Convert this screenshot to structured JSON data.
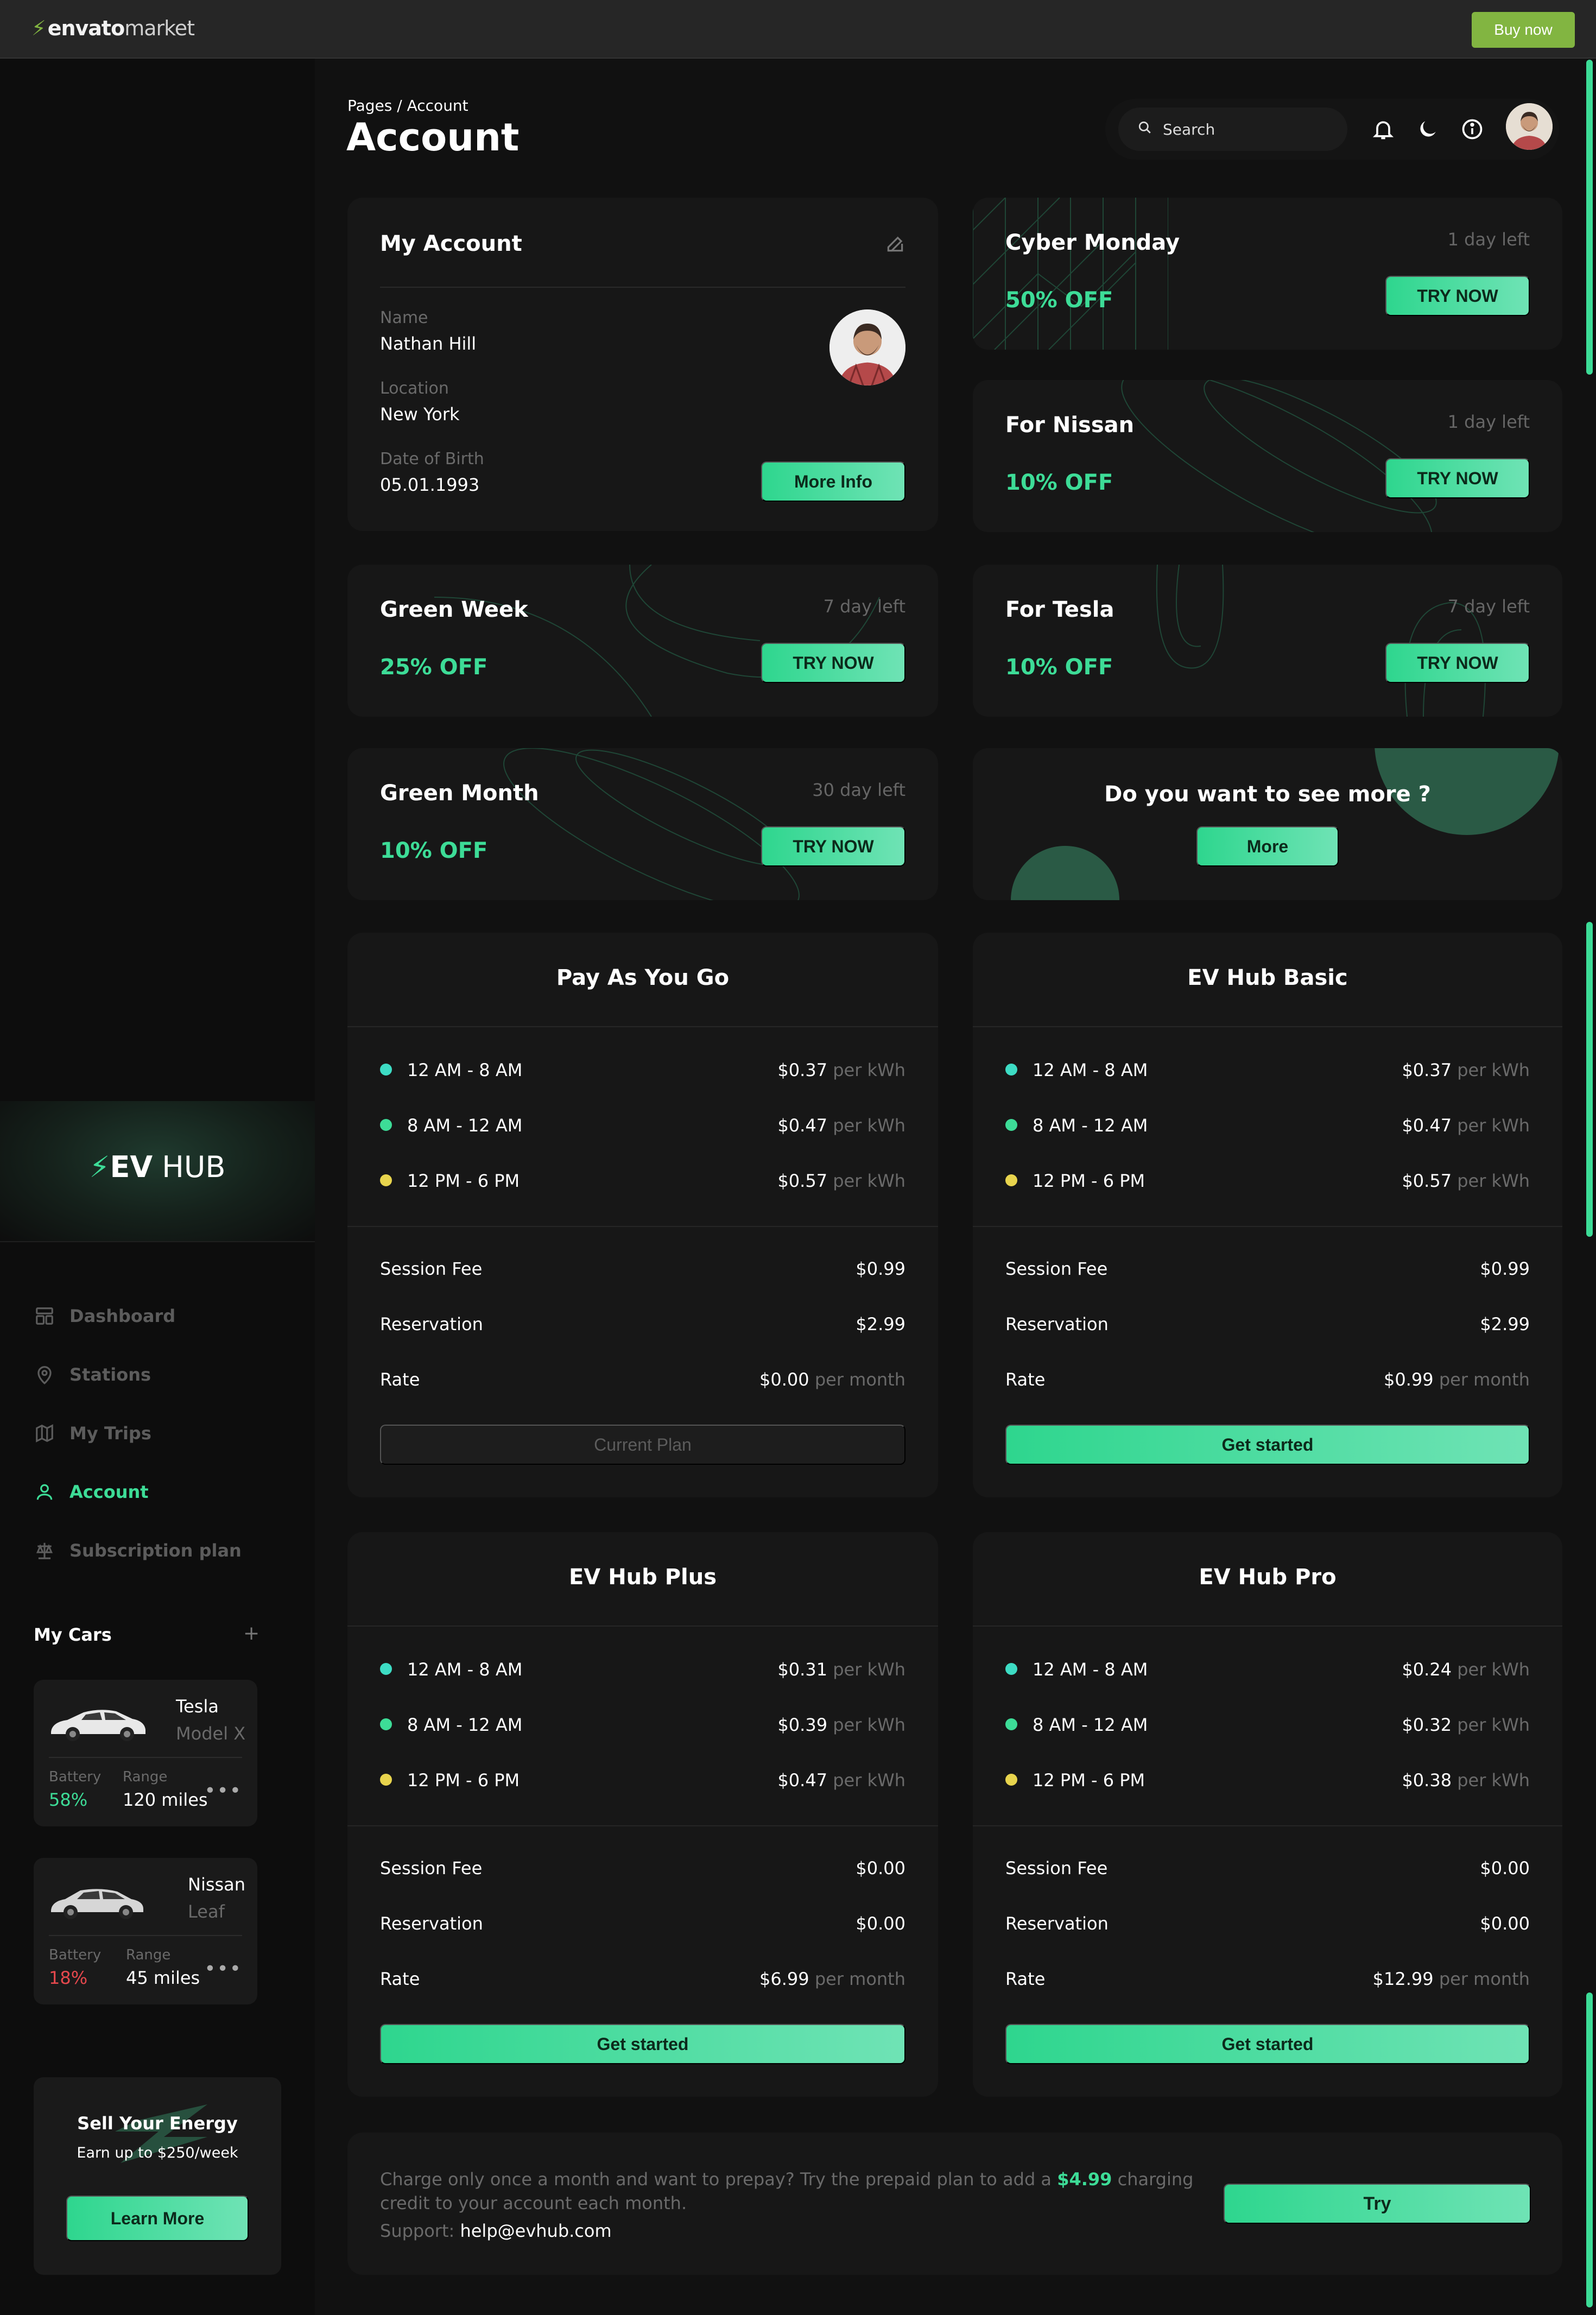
{
  "topbar": {
    "logo_main": "envato",
    "logo_sub": "market",
    "buy_now": "Buy now"
  },
  "brand": {
    "ev": "EV",
    "hub": "HUB"
  },
  "nav": [
    {
      "label": "Dashboard",
      "icon": "dashboard-icon",
      "active": false
    },
    {
      "label": "Stations",
      "icon": "map-pin-icon",
      "active": false
    },
    {
      "label": "My Trips",
      "icon": "map-icon",
      "active": false
    },
    {
      "label": "Account",
      "icon": "user-icon",
      "active": true
    },
    {
      "label": "Subscription plan",
      "icon": "scale-icon",
      "active": false
    }
  ],
  "my_cars": {
    "title": "My Cars",
    "add": "+",
    "cars": [
      {
        "name": "Tesla",
        "model": "Model X",
        "battery_label": "Battery",
        "battery": "58%",
        "battery_color": "#3ddc97",
        "range_label": "Range",
        "range": "120 miles"
      },
      {
        "name": "Nissan",
        "model": "Leaf",
        "battery_label": "Battery",
        "battery": "18%",
        "battery_color": "#e5484d",
        "range_label": "Range",
        "range": "45 miles"
      }
    ]
  },
  "sell": {
    "title": "Sell Your Energy",
    "subtitle": "Earn up to $250/week",
    "button": "Learn More"
  },
  "header": {
    "breadcrumb": "Pages / Account",
    "title": "Account",
    "search_placeholder": "Search"
  },
  "account": {
    "title": "My Account",
    "name_label": "Name",
    "name": "Nathan Hill",
    "location_label": "Location",
    "location": "New York",
    "dob_label": "Date of Birth",
    "dob": "05.01.1993",
    "button": "More Info"
  },
  "promos": [
    {
      "title": "Cyber Monday",
      "days": "1 day left",
      "off": "50% OFF",
      "button": "TRY NOW"
    },
    {
      "title": "For Nissan",
      "days": "1 day left",
      "off": "10% OFF",
      "button": "TRY NOW"
    },
    {
      "title": "Green Week",
      "days": "7 day left",
      "off": "25% OFF",
      "button": "TRY NOW"
    },
    {
      "title": "For Tesla",
      "days": "7 day left",
      "off": "10% OFF",
      "button": "TRY NOW"
    },
    {
      "title": "Green Month",
      "days": "30 day left",
      "off": "10% OFF",
      "button": "TRY NOW"
    }
  ],
  "more_card": {
    "title": "Do you want to see more ?",
    "button": "More"
  },
  "plans": [
    {
      "title": "Pay As You Go",
      "rows": [
        {
          "time": "12 AM - 8 AM",
          "price": "$0.37",
          "unit": "per kWh",
          "dot": "#3ddcc4"
        },
        {
          "time": "8 AM - 12 AM",
          "price": "$0.47",
          "unit": "per kWh",
          "dot": "#3ddc97"
        },
        {
          "time": "12 PM - 6 PM",
          "price": "$0.57",
          "unit": "per kWh",
          "dot": "#e8d44d"
        }
      ],
      "session_label": "Session Fee",
      "session": "$0.99",
      "reservation_label": "Reservation",
      "reservation": "$2.99",
      "rate_label": "Rate",
      "rate": "$0.00",
      "rate_unit": "per month",
      "button": "Current Plan"
    },
    {
      "title": "EV Hub Basic",
      "rows": [
        {
          "time": "12 AM - 8 AM",
          "price": "$0.37",
          "unit": "per kWh",
          "dot": "#3ddcc4"
        },
        {
          "time": "8 AM - 12 AM",
          "price": "$0.47",
          "unit": "per kWh",
          "dot": "#3ddc97"
        },
        {
          "time": "12 PM - 6 PM",
          "price": "$0.57",
          "unit": "per kWh",
          "dot": "#e8d44d"
        }
      ],
      "session_label": "Session Fee",
      "session": "$0.99",
      "reservation_label": "Reservation",
      "reservation": "$2.99",
      "rate_label": "Rate",
      "rate": "$0.99",
      "rate_unit": "per month",
      "button": "Get started"
    },
    {
      "title": "EV Hub Plus",
      "rows": [
        {
          "time": "12 AM - 8 AM",
          "price": "$0.31",
          "unit": "per kWh",
          "dot": "#3ddcc4"
        },
        {
          "time": "8 AM - 12 AM",
          "price": "$0.39",
          "unit": "per kWh",
          "dot": "#3ddc97"
        },
        {
          "time": "12 PM - 6 PM",
          "price": "$0.47",
          "unit": "per kWh",
          "dot": "#e8d44d"
        }
      ],
      "session_label": "Session Fee",
      "session": "$0.00",
      "reservation_label": "Reservation",
      "reservation": "$0.00",
      "rate_label": "Rate",
      "rate": "$6.99",
      "rate_unit": "per month",
      "button": "Get started"
    },
    {
      "title": "EV Hub Pro",
      "rows": [
        {
          "time": "12 AM - 8 AM",
          "price": "$0.24",
          "unit": "per kWh",
          "dot": "#3ddcc4"
        },
        {
          "time": "8 AM - 12 AM",
          "price": "$0.32",
          "unit": "per kWh",
          "dot": "#3ddc97"
        },
        {
          "time": "12 PM - 6 PM",
          "price": "$0.38",
          "unit": "per kWh",
          "dot": "#e8d44d"
        }
      ],
      "session_label": "Session Fee",
      "session": "$0.00",
      "reservation_label": "Reservation",
      "reservation": "$0.00",
      "rate_label": "Rate",
      "rate": "$12.99",
      "rate_unit": "per month",
      "button": "Get started"
    }
  ],
  "footer": {
    "text_before": "Charge only once a month and want to prepay? Try the prepaid plan to add a ",
    "amount": "$4.99",
    "text_after": " charging credit to your account each month.",
    "support_label": "Support:",
    "support_email": "help@evhub.com",
    "button": "Try"
  },
  "colors": {
    "accent": "#3ddc97",
    "background": "#111111",
    "card": "#171717",
    "envato_green": "#82b541"
  }
}
